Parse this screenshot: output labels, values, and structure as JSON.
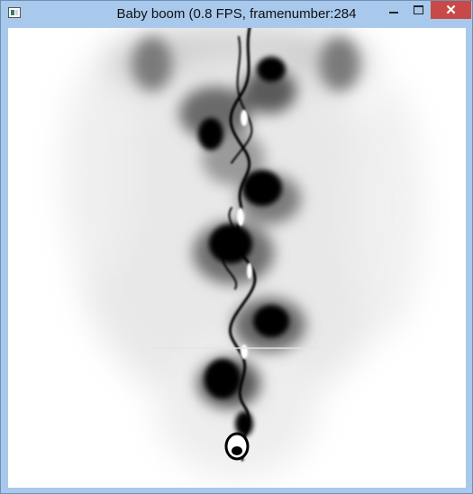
{
  "window": {
    "title": "Baby boom (0.8 FPS, framenumber:284"
  },
  "controls": {
    "minimize_icon": "minimize-icon",
    "maximize_icon": "maximize-icon",
    "close_icon": "close-icon",
    "close_glyph": "✕"
  },
  "colors": {
    "frame": "#a8c8ec",
    "close_button": "#c74a48",
    "canvas": "#ffffff",
    "ink": "#000000"
  }
}
